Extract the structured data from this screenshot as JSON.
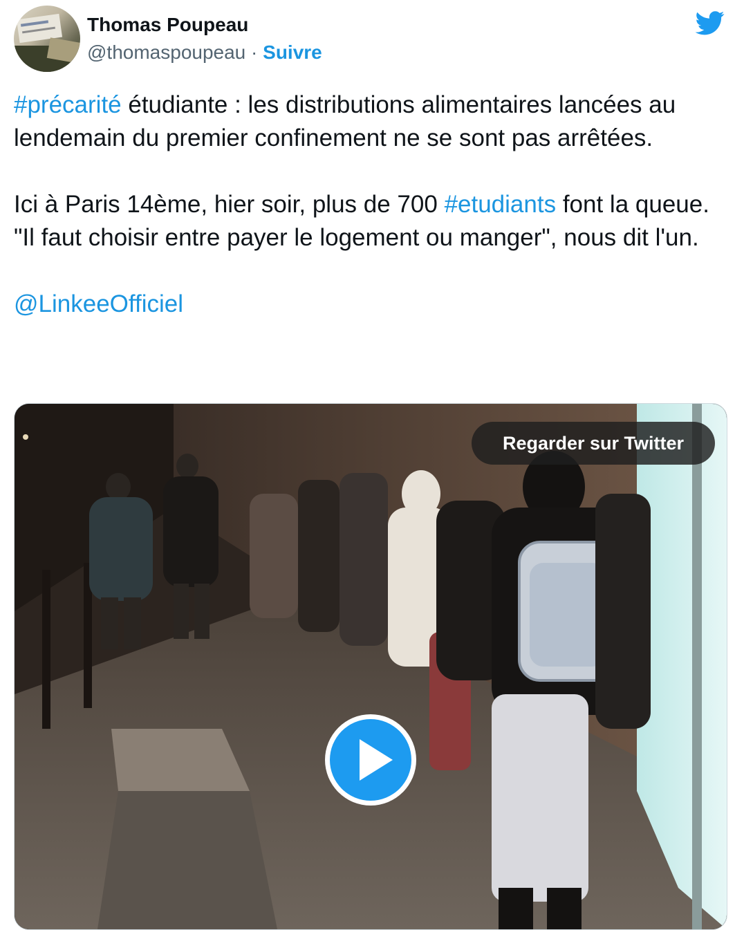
{
  "author": {
    "name": "Thomas Poupeau",
    "handle": "@thomaspoupeau",
    "separator": "·",
    "follow_label": "Suivre"
  },
  "tweet": {
    "para1_hashtag": "#précarité",
    "para1_text": " étudiante : les distributions alimentaires lancées au lendemain du premier confinement ne se sont pas arrêtées.",
    "para2_text_a": "Ici à Paris 14ème, hier soir, plus de 700 ",
    "para2_hashtag": "#etudiants",
    "para2_text_b": " font la queue. \"Il faut choisir entre payer le logement ou manger\", nous dit l'un.",
    "mention": "@LinkeeOfficiel"
  },
  "media": {
    "watch_label": "Regarder sur Twitter"
  },
  "icons": {
    "brand": "twitter-bird-icon",
    "play": "play-icon"
  },
  "colors": {
    "link": "#1b95e0",
    "twitter_blue": "#1d9bf0",
    "text": "#0f1419",
    "muted": "#536471"
  }
}
